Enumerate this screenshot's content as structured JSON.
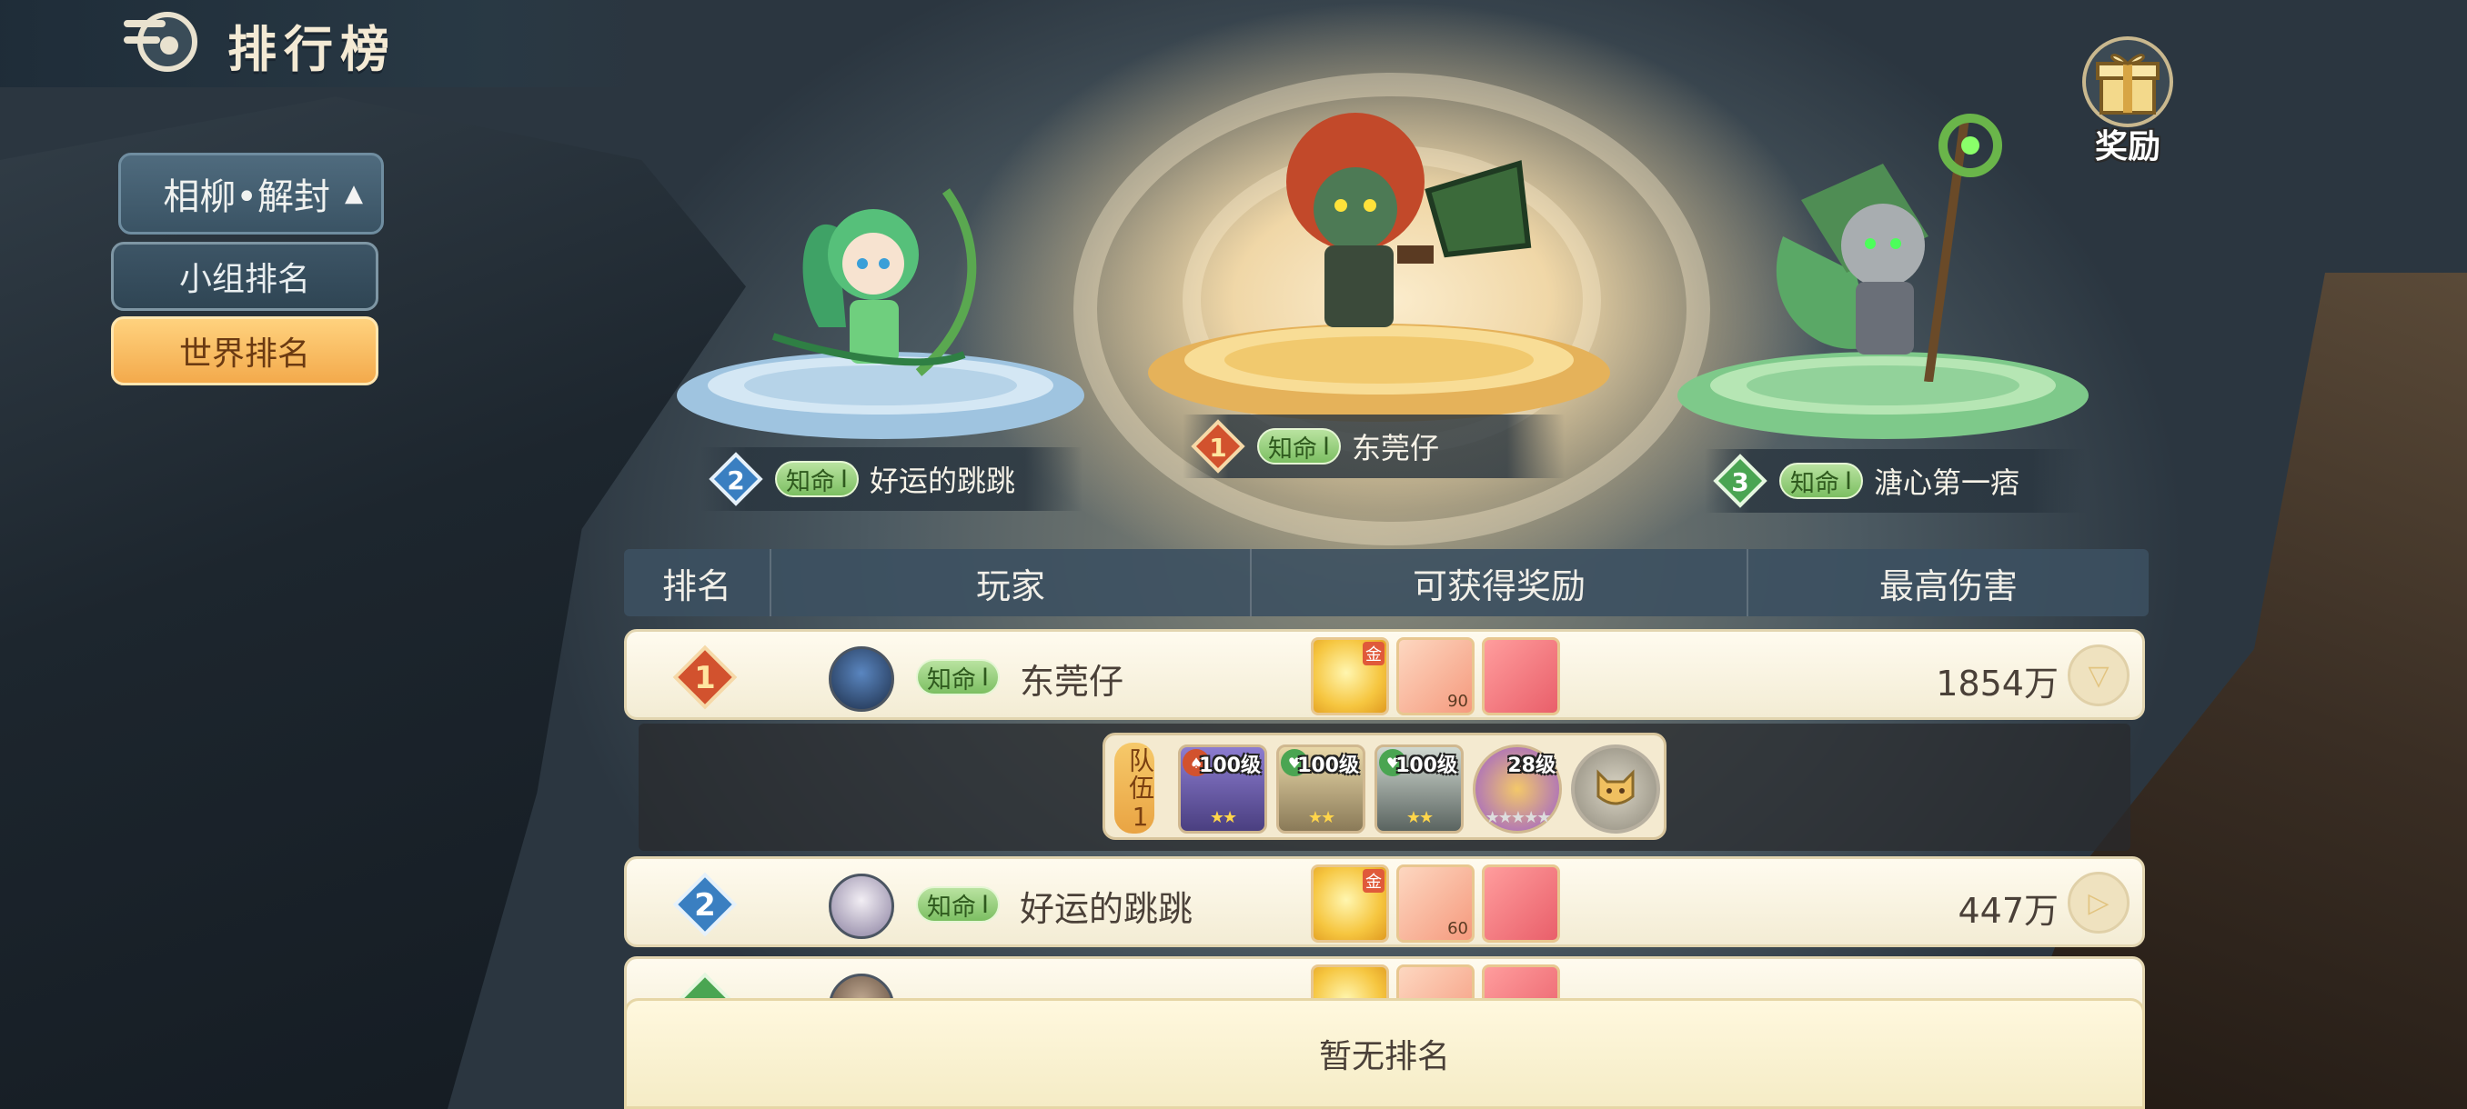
{
  "header": {
    "title": "排行榜"
  },
  "left_menu": {
    "mode_label": "相柳•解封",
    "group_rank": "小组排名",
    "world_rank": "世界排名"
  },
  "reward": {
    "label": "奖励"
  },
  "podium": [
    {
      "rank": "2",
      "title": "知命",
      "title_level": "Ⅰ",
      "name": "好运的跳跳"
    },
    {
      "rank": "1",
      "title": "知命",
      "title_level": "Ⅰ",
      "name": "东莞仔"
    },
    {
      "rank": "3",
      "title": "知命",
      "title_level": "Ⅰ",
      "name": "溏心第一痞"
    }
  ],
  "table": {
    "headers": [
      "排名",
      "玩家",
      "可获得奖励",
      "最高伤害"
    ],
    "rows": [
      {
        "rank": "1",
        "title": "知命",
        "title_level": "Ⅰ",
        "name": "东莞仔",
        "damage": "1854万",
        "item_counts": [
          "",
          "90",
          ""
        ],
        "gold_tag": "金"
      },
      {
        "rank": "2",
        "title": "知命",
        "title_level": "Ⅰ",
        "name": "好运的跳跳",
        "damage": "447万",
        "item_counts": [
          "",
          "60",
          ""
        ],
        "gold_tag": "金"
      }
    ]
  },
  "team": {
    "label": "队伍1",
    "heroes": [
      {
        "level": "100级"
      },
      {
        "level": "100级"
      },
      {
        "level": "100级"
      },
      {
        "level": "28级"
      }
    ]
  },
  "empty_text": "暂无排名",
  "colors": {
    "gold_button": "#f3aa4c",
    "panel": "#3d5566",
    "row_bg": "#fffbef",
    "rank1": "#d2522e",
    "rank2": "#3a7fc1",
    "rank3": "#4aa552"
  }
}
